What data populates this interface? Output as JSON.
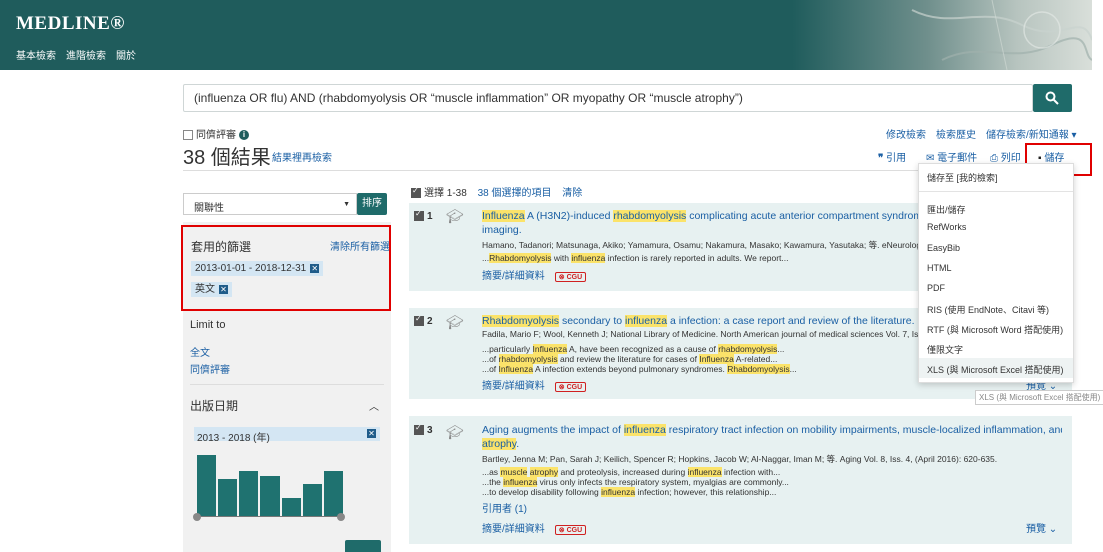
{
  "header": {
    "logo": "MEDLINE®",
    "nav": [
      "基本檢索",
      "進階檢索",
      "關於"
    ]
  },
  "search": {
    "query": "(influenza OR flu) AND (rhabdomyolysis OR “muscle inflammation” OR myopathy OR “muscle atrophy”)"
  },
  "peer_reviewed_label": "同儕評審",
  "result_count": "38 個結果",
  "refine_link": "結果裡再檢索",
  "top_links": [
    "修改檢索",
    "檢索歷史",
    "儲存檢索/新知通報 ▾"
  ],
  "actions": {
    "cite": "引用",
    "email": "電子郵件",
    "print": "列印",
    "save": "儲存"
  },
  "sidebar": {
    "sort_value": "關聯性",
    "sort_button": "排序",
    "applied_filters_title": "套用的篩選",
    "clear_all": "清除所有篩選",
    "filters": [
      "2013-01-01 - 2018-12-31",
      "英文"
    ],
    "limit_to_title": "Limit to",
    "limit_links": [
      "全文",
      "同儕評審"
    ],
    "date_title": "出版日期",
    "date_range": "2013 - 2018 (年)",
    "histogram": [
      0.85,
      0.52,
      0.62,
      0.55,
      0.25,
      0.45,
      0.62
    ],
    "bottom_label": "..."
  },
  "selection": {
    "select_label": "選擇 1-38",
    "selected_items": "38 個選擇的項目",
    "clear": "清除"
  },
  "results": [
    {
      "num": "1",
      "title_parts": [
        {
          "t": "Influenza",
          "h": true
        },
        {
          "t": " A (H3N2)-induced ",
          "h": false
        },
        {
          "t": "rhabdomyolysis",
          "h": true
        },
        {
          "t": " complicating acute anterior compartment syndrome: Serial change",
          "h": false
        }
      ],
      "title_line2": "imaging.",
      "authors": "Hamano, Tadanori; Matsunaga, Akiko; Yamamura, Osamu; Nakamura, Masako; Kawamura, Yasutaka; 等. eNeurologicalSci Vo",
      "snippets": [
        [
          {
            "t": "...",
            "h": false
          },
          {
            "t": "Rhabdomyolysis",
            "h": true
          },
          {
            "t": " with ",
            "h": false
          },
          {
            "t": "influenza",
            "h": true
          },
          {
            "t": " infection is rarely reported in adults. We report...",
            "h": false
          }
        ]
      ],
      "detail": "摘要/詳細資料",
      "cgu": "⊗ CGU"
    },
    {
      "num": "2",
      "title_parts": [
        {
          "t": "Rhabdomyolysis",
          "h": true
        },
        {
          "t": " secondary to ",
          "h": false
        },
        {
          "t": "influenza",
          "h": true
        },
        {
          "t": " a infection: a case report and review of the literature.",
          "h": false
        }
      ],
      "authors": "Fadila, Mario F; Wool, Kenneth J; National Library of Medicine. North American journal of medical sciences Vol. 7, Iss. 3, (Ma",
      "snippets": [
        [
          {
            "t": "...particularly ",
            "h": false
          },
          {
            "t": "Influenza",
            "h": true
          },
          {
            "t": " A, have been recognized as a cause of ",
            "h": false
          },
          {
            "t": "rhabdomyolysis",
            "h": true
          },
          {
            "t": "...",
            "h": false
          }
        ],
        [
          {
            "t": "...of ",
            "h": false
          },
          {
            "t": "rhabdomyolysis",
            "h": true
          },
          {
            "t": " and review the literature for cases of ",
            "h": false
          },
          {
            "t": "Influenza",
            "h": true
          },
          {
            "t": " A-related...",
            "h": false
          }
        ],
        [
          {
            "t": "...of ",
            "h": false
          },
          {
            "t": "Influenza",
            "h": true
          },
          {
            "t": " A infection extends beyond pulmonary syndromes. ",
            "h": false
          },
          {
            "t": "Rhabdomyolysis",
            "h": true
          },
          {
            "t": "...",
            "h": false
          }
        ]
      ],
      "detail": "摘要/詳細資料",
      "cgu": "⊗ CGU",
      "preview": "預覽 ⌄"
    },
    {
      "num": "3",
      "title_parts": [
        {
          "t": "Aging augments the impact of ",
          "h": false
        },
        {
          "t": "influenza",
          "h": true
        },
        {
          "t": " respiratory tract infection on mobility impairments, muscle-localized inflammation, and ",
          "h": false
        },
        {
          "t": "muscle",
          "h": true
        }
      ],
      "title_line2_parts": [
        {
          "t": "atrophy",
          "h": true
        },
        {
          "t": ".",
          "h": false
        }
      ],
      "authors": "Bartley, Jenna M; Pan, Sarah J; Keilich, Spencer R; Hopkins, Jacob W; Al-Naggar, Iman M; 等. Aging Vol. 8, Iss. 4, (April 2016): 620-635.",
      "snippets": [
        [
          {
            "t": "...as ",
            "h": false
          },
          {
            "t": "muscle",
            "h": true
          },
          {
            "t": " ",
            "h": false
          },
          {
            "t": "atrophy",
            "h": true
          },
          {
            "t": " and proteolysis, increased during ",
            "h": false
          },
          {
            "t": "influenza",
            "h": true
          },
          {
            "t": " infection with...",
            "h": false
          }
        ],
        [
          {
            "t": "...the ",
            "h": false
          },
          {
            "t": "influenza",
            "h": true
          },
          {
            "t": " virus only infects the respiratory system, myalgias are commonly...",
            "h": false
          }
        ],
        [
          {
            "t": "...to develop disability following ",
            "h": false
          },
          {
            "t": "influenza",
            "h": true
          },
          {
            "t": " infection; however, this relationship...",
            "h": false
          }
        ]
      ],
      "cited_by": "引用者 (1)",
      "detail": "摘要/詳細資料",
      "cgu": "⊗ CGU",
      "preview": "預覽 ⌄"
    }
  ],
  "save_menu": {
    "items": [
      "儲存至 [我的檢索]",
      "匯出/儲存",
      "RefWorks",
      "EasyBib",
      "HTML",
      "PDF",
      "RIS (使用 EndNote、Citavi 等)",
      "RTF (與 Microsoft Word 搭配使用)",
      "僅限文字",
      "XLS (與 Microsoft Excel 搭配使用)"
    ],
    "tooltip": "XLS (與 Microsoft Excel 搭配使用)"
  },
  "colors": {
    "header": "#1f5c5c",
    "button": "#1f6b6a",
    "link": "#1a5fa4",
    "highlight": "#fbe36a",
    "callout": "#e00000"
  }
}
